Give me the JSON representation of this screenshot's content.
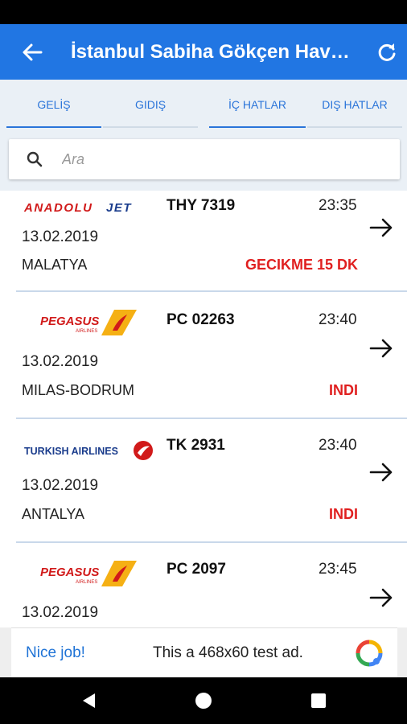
{
  "app_bar": {
    "title": "İstanbul Sabiha Gökçen Havalimanı",
    "back_icon": "arrow-left-icon",
    "refresh_icon": "refresh-icon",
    "background": "#2176e3"
  },
  "tabs": [
    {
      "label": "GELİŞ",
      "active": true
    },
    {
      "label": "GIDIŞ",
      "active": false
    },
    {
      "label": "İÇ HATLAR",
      "active": true
    },
    {
      "label": "DIŞ HATLAR",
      "active": false
    }
  ],
  "search": {
    "placeholder": "Ara",
    "value": ""
  },
  "flights": [
    {
      "airline_logo": "ANADOLUJET",
      "flight_no": "THY 7319",
      "time": "23:35",
      "date": "13.02.2019",
      "city": "MALATYA",
      "status": "GECIKME 15 DK"
    },
    {
      "airline_logo": "PEGASUS",
      "flight_no": "PC 02263",
      "time": "23:40",
      "date": "13.02.2019",
      "city": "MILAS-BODRUM",
      "status": "INDI"
    },
    {
      "airline_logo": "TURKISH AIRLINES",
      "flight_no": "TK 2931",
      "time": "23:40",
      "date": "13.02.2019",
      "city": "ANTALYA",
      "status": "INDI"
    },
    {
      "airline_logo": "PEGASUS",
      "flight_no": "PC 2097",
      "time": "23:45",
      "date": "13.02.2019",
      "city": "",
      "status": ""
    }
  ],
  "ad": {
    "left_text": "Nice job!",
    "text": "This a 468x60 test ad."
  },
  "colors": {
    "accent": "#2176e3",
    "status_red": "#e02020",
    "tab_text": "#2a74d9"
  }
}
